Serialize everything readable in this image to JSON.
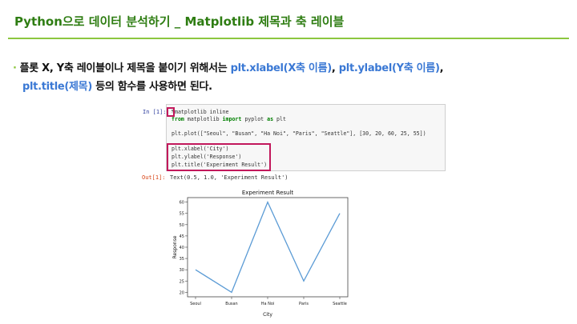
{
  "header": {
    "title": "Python으로 데이터 분석하기 _ Matplotlib 제목과 축 레이블"
  },
  "bullet": {
    "line1_a": "플롯 X, Y축 레이블이나 제목을 붙이기 위해서는 ",
    "line1_b": "plt.xlabel(X축 이름)",
    "line1_c": ", ",
    "line1_d": "plt.ylabel(Y축 이름)",
    "line1_e": ",",
    "line2_a": "plt.title(제목)",
    "line2_b": " 등의 함수를 사용하면 된다."
  },
  "notebook": {
    "in_prompt": "In [1]:",
    "out_prompt": "Out[1]:",
    "code": {
      "l1": "%matplotlib inline",
      "l2_kw1": "from",
      "l2_mod": " matplotlib ",
      "l2_kw2": "import",
      "l2_rest": " pyplot ",
      "l2_kw3": "as",
      "l2_alias": " plt",
      "l3": "plt.plot([\"Seoul\", \"Busan\", \"Ha Noi\", \"Paris\", \"Seattle\"], [30, 20, 60, 25, 55])",
      "l4": "plt.xlabel('City')",
      "l5": "plt.ylabel('Response')",
      "l6": "plt.title('Experiment Result')"
    },
    "output_text": "Text(0.5, 1.0, 'Experiment Result')"
  },
  "chart_data": {
    "type": "line",
    "title": "Experiment Result",
    "xlabel": "City",
    "ylabel": "Response",
    "categories": [
      "Seoul",
      "Busan",
      "Ha Noi",
      "Paris",
      "Seattle"
    ],
    "values": [
      30,
      20,
      60,
      25,
      55
    ],
    "yticks": [
      20,
      25,
      30,
      35,
      40,
      45,
      50,
      55,
      60
    ],
    "ylim": [
      18,
      62
    ],
    "line_color": "#5b9bd5"
  },
  "colors": {
    "title_green": "#2e7d12",
    "rule_green": "#8cc63f",
    "link_blue": "#3a78d4",
    "highlight": "#c2185b"
  }
}
